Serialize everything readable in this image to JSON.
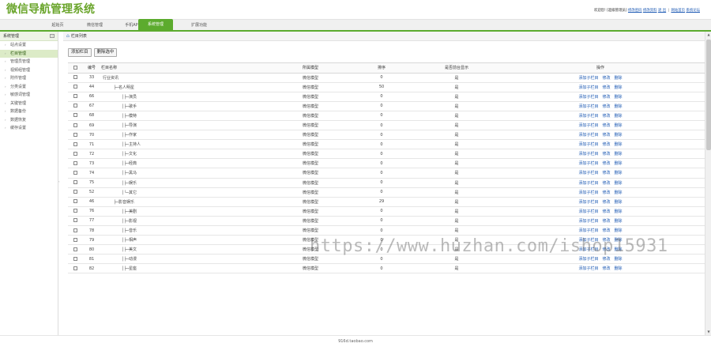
{
  "header": {
    "logo": "微信导航管理系统",
    "welcome": "欢迎您! [超级管理员]",
    "links": [
      "修改密码",
      "修改资料",
      "退 出",
      "网站首页",
      "系统论坛"
    ]
  },
  "nav": {
    "tabs": [
      {
        "label": "起始页",
        "active": false
      },
      {
        "label": "微信管理",
        "active": false
      },
      {
        "label": "手机APP",
        "active": false
      },
      {
        "label": "系统管理",
        "active": true
      },
      {
        "label": "扩展功能",
        "active": false
      }
    ]
  },
  "sidebar": {
    "title": "系统管理",
    "items": [
      {
        "label": "站点设置",
        "active": false
      },
      {
        "label": "栏目管理",
        "active": true
      },
      {
        "label": "管理员管理",
        "active": false
      },
      {
        "label": "视频组管理",
        "active": false
      },
      {
        "label": "附件管理",
        "active": false
      },
      {
        "label": "分类设置",
        "active": false
      },
      {
        "label": "敏感词管理",
        "active": false
      },
      {
        "label": "关键管理",
        "active": false
      },
      {
        "label": "数据备份",
        "active": false
      },
      {
        "label": "数据恢复",
        "active": false
      },
      {
        "label": "缓存设置",
        "active": false
      }
    ]
  },
  "main": {
    "breadcrumb": "栏目列表",
    "toolbar": {
      "add_label": "添加栏目",
      "delete_label": "删除选中"
    },
    "columns": [
      "",
      "编号",
      "栏目名称",
      "所属模型",
      "排序",
      "是否前台显示",
      "操作"
    ],
    "actions": [
      "添加子栏目",
      "修改",
      "删除"
    ],
    "rows": [
      {
        "id": "33",
        "name": "行业资讯",
        "indent": 0,
        "model": "微信模型",
        "sort": "0",
        "display": "是"
      },
      {
        "id": "44",
        "name": "├─名人明星",
        "indent": 1,
        "model": "微信模型",
        "sort": "50",
        "display": "是"
      },
      {
        "id": "66",
        "name": "│├─演员",
        "indent": 2,
        "model": "微信模型",
        "sort": "0",
        "display": "是"
      },
      {
        "id": "67",
        "name": "│├─歌手",
        "indent": 2,
        "model": "微信模型",
        "sort": "0",
        "display": "是"
      },
      {
        "id": "68",
        "name": "│├─模特",
        "indent": 2,
        "model": "微信模型",
        "sort": "0",
        "display": "是"
      },
      {
        "id": "69",
        "name": "│├─导演",
        "indent": 2,
        "model": "微信模型",
        "sort": "0",
        "display": "是"
      },
      {
        "id": "70",
        "name": "│├─作家",
        "indent": 2,
        "model": "微信模型",
        "sort": "0",
        "display": "是"
      },
      {
        "id": "71",
        "name": "│├─主持人",
        "indent": 2,
        "model": "微信模型",
        "sort": "0",
        "display": "是"
      },
      {
        "id": "72",
        "name": "│├─文化",
        "indent": 2,
        "model": "微信模型",
        "sort": "0",
        "display": "是"
      },
      {
        "id": "73",
        "name": "│├─经典",
        "indent": 2,
        "model": "微信模型",
        "sort": "0",
        "display": "是"
      },
      {
        "id": "74",
        "name": "│├─黑马",
        "indent": 2,
        "model": "微信模型",
        "sort": "0",
        "display": "是"
      },
      {
        "id": "75",
        "name": "│├─娱乐",
        "indent": 2,
        "model": "微信模型",
        "sort": "0",
        "display": "是"
      },
      {
        "id": "52",
        "name": "│└─其它",
        "indent": 2,
        "model": "微信模型",
        "sort": "0",
        "display": "是"
      },
      {
        "id": "46",
        "name": "├─影音娱乐",
        "indent": 1,
        "model": "微信模型",
        "sort": "29",
        "display": "是"
      },
      {
        "id": "76",
        "name": "│├─美剧",
        "indent": 2,
        "model": "微信模型",
        "sort": "0",
        "display": "是"
      },
      {
        "id": "77",
        "name": "│├─影视",
        "indent": 2,
        "model": "微信模型",
        "sort": "0",
        "display": "是"
      },
      {
        "id": "78",
        "name": "│├─音乐",
        "indent": 2,
        "model": "微信模型",
        "sort": "0",
        "display": "是"
      },
      {
        "id": "79",
        "name": "│├─相声",
        "indent": 2,
        "model": "微信模型",
        "sort": "0",
        "display": "是"
      },
      {
        "id": "80",
        "name": "│├─美文",
        "indent": 2,
        "model": "微信模型",
        "sort": "0",
        "display": "是"
      },
      {
        "id": "81",
        "name": "│├─动漫",
        "indent": 2,
        "model": "微信模型",
        "sort": "0",
        "display": "是"
      },
      {
        "id": "82",
        "name": "│├─星座",
        "indent": 2,
        "model": "微信模型",
        "sort": "0",
        "display": "是"
      }
    ]
  },
  "footer": {
    "text": "916d.taobao.com"
  },
  "watermark": {
    "text": "https://www.huzhan.com/ishop15931"
  },
  "colors": {
    "accent": "#5cab2e",
    "link": "#1b58b3",
    "logo": "#6aa52b"
  }
}
